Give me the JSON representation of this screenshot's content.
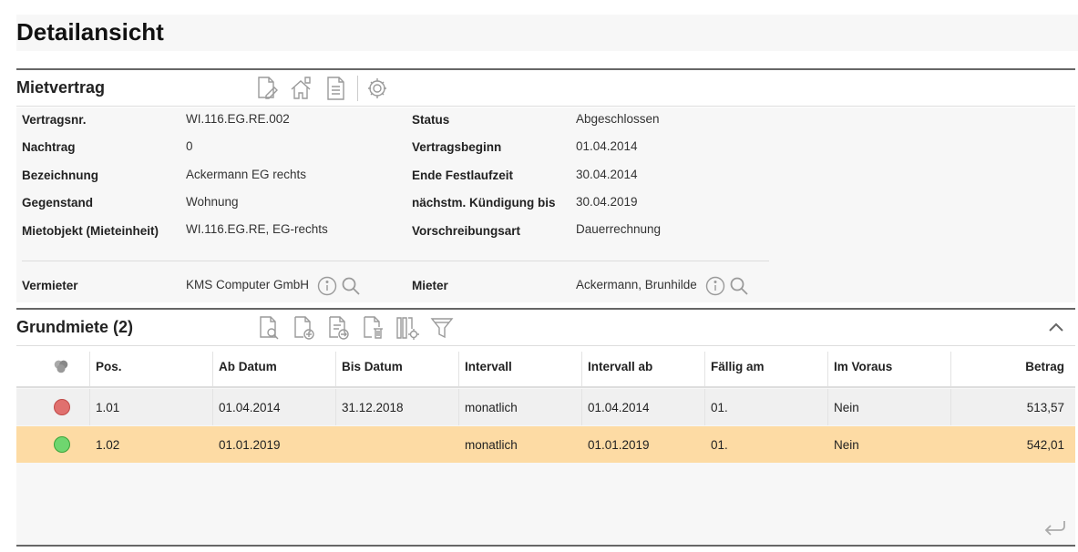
{
  "page": {
    "title": "Detailansicht"
  },
  "colors": {
    "accent_row": "#fddba4",
    "status_red": "#e0706e",
    "status_green": "#6fd66f",
    "icon_gray": "#9a9a9a"
  },
  "contract": {
    "section_title": "Mietvertrag",
    "toolbar_icons": [
      "edit-document-icon",
      "house-document-icon",
      "document-icon",
      "settings-icon"
    ],
    "left": [
      {
        "label": "Vertragsnr.",
        "value": "WI.116.EG.RE.002"
      },
      {
        "label": "Nachtrag",
        "value": "0"
      },
      {
        "label": "Bezeichnung",
        "value": "Ackermann EG rechts"
      },
      {
        "label": "Gegenstand",
        "value": "Wohnung"
      },
      {
        "label": "Mietobjekt (Mieteinheit)",
        "value": "WI.116.EG.RE, EG-rechts"
      }
    ],
    "right": [
      {
        "label": "Status",
        "value": "Abgeschlossen"
      },
      {
        "label": "Vertragsbeginn",
        "value": "01.04.2014"
      },
      {
        "label": "Ende Festlaufzeit",
        "value": "30.04.2014"
      },
      {
        "label": "nächstm. Kündigung bis",
        "value": "30.04.2019"
      },
      {
        "label": "Vorschreibungsart",
        "value": "Dauerrechnung"
      }
    ],
    "landlord": {
      "label": "Vermieter",
      "value": "KMS Computer GmbH"
    },
    "tenant": {
      "label": "Mieter",
      "value": "Ackermann, Brunhilde"
    }
  },
  "rent": {
    "section_title": "Grundmiete (2)",
    "toolbar_icons": [
      "search-document-icon",
      "add-document-icon",
      "export-document-icon",
      "delete-document-icon",
      "column-settings-icon",
      "filter-icon"
    ],
    "columns": [
      "Pos.",
      "Ab Datum",
      "Bis Datum",
      "Intervall",
      "Intervall ab",
      "Fällig am",
      "Im Voraus",
      "Betrag"
    ],
    "rows": [
      {
        "status": "red",
        "pos": "1.01",
        "ab": "01.04.2014",
        "bis": "31.12.2018",
        "intervall": "monatlich",
        "intervall_ab": "01.04.2014",
        "faellig": "01.",
        "voraus": "Nein",
        "betrag": "513,57"
      },
      {
        "status": "green",
        "pos": "1.02",
        "ab": "01.01.2019",
        "bis": "",
        "intervall": "monatlich",
        "intervall_ab": "01.01.2019",
        "faellig": "01.",
        "voraus": "Nein",
        "betrag": "542,01"
      }
    ]
  }
}
